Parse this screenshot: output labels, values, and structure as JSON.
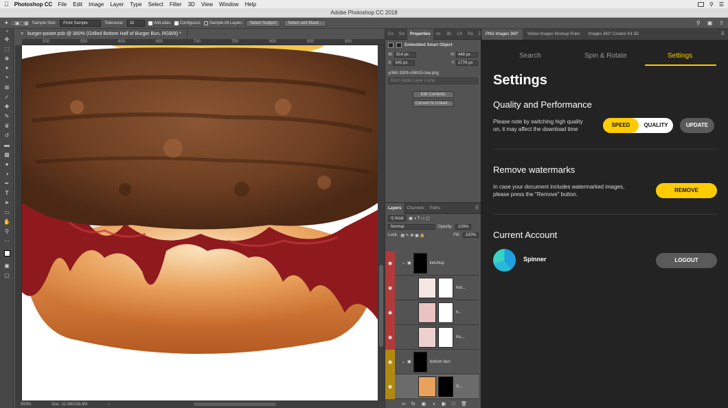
{
  "menubar": {
    "app_name": "Photoshop CC",
    "items": [
      "File",
      "Edit",
      "Image",
      "Layer",
      "Type",
      "Select",
      "Filter",
      "3D",
      "View",
      "Window",
      "Help"
    ]
  },
  "window": {
    "title": "Adobe Photoshop CC 2018"
  },
  "options_bar": {
    "sample_size_label": "Sample Size:",
    "sample_size_value": "Point Sample",
    "tolerance_label": "Tolerance:",
    "tolerance_value": "32",
    "anti_alias_label": "Anti-alias",
    "contiguous_label": "Contiguous",
    "sample_all_label": "Sample All Layers",
    "select_subject_label": "Select Subject",
    "select_mask_label": "Select and Mask..."
  },
  "document": {
    "tab_title": "burger-poster.psb @ 300% (Grilled Bottom Half of Burger Bun, RGB/8) *",
    "ruler_ticks": [
      "500",
      "550",
      "600",
      "650",
      "700",
      "750",
      "800",
      "850",
      "900",
      "950"
    ],
    "zoom": "300%",
    "doc_info": "Doc: 11.0M/158.6M"
  },
  "properties_panel": {
    "tabs": [
      "Co",
      "Sw",
      "Properties",
      "Ac",
      "3D",
      "Ch",
      "Pa"
    ],
    "object_type": "Embedded Smart Object",
    "w_label": "W:",
    "w_value": "914 px",
    "h_label": "H:",
    "h_value": "448 px",
    "x_label": "X:",
    "x_value": "345 px",
    "y_label": "Y:",
    "y_value": "1776 px",
    "filename": "yi360-3309-v06h15-low.png",
    "layer_comp": "Don't Apply Layer Comp",
    "edit_contents": "Edit Contents",
    "convert_linked": "Convert to Linked..."
  },
  "layers_panel": {
    "tabs": [
      "Layers",
      "Channels",
      "Paths"
    ],
    "filter_kind": "Kind",
    "blend_mode": "Normal",
    "opacity_label": "Opacity:",
    "opacity_value": "100%",
    "lock_label": "Lock:",
    "fill_label": "Fill:",
    "fill_value": "100%",
    "layers": [
      {
        "name": "ketchup",
        "type": "group",
        "color": "red"
      },
      {
        "name": "Ket...",
        "type": "smart",
        "color": "red"
      },
      {
        "name": "K...",
        "type": "smart",
        "color": "red"
      },
      {
        "name": "Ke...",
        "type": "smart",
        "color": "red"
      },
      {
        "name": "bottom bun",
        "type": "group",
        "color": "yellow"
      },
      {
        "name": "G...",
        "type": "smart",
        "color": "yellow"
      }
    ]
  },
  "plugin": {
    "tabs": [
      "PNG Images 360°",
      "Yellow Images Mockup Ruler",
      "Images 360° Creator Kit 3D"
    ],
    "nav": [
      "Search",
      "Spin & Rotate",
      "Settings"
    ],
    "title": "Settings",
    "quality": {
      "heading": "Quality and Performance",
      "description_1": "Please note by switching high quality",
      "description_2": "on, it may affect the download time",
      "speed_label": "SPEED",
      "quality_label": "QUALITY",
      "update_label": "UPDATE"
    },
    "watermarks": {
      "heading": "Remove watermarks",
      "description_1": "In case your document includes watermarked images,",
      "description_2": "please press the \"Remove\" button.",
      "remove_label": "REMOVE"
    },
    "account": {
      "heading": "Current Account",
      "username": "Spinner",
      "logout_label": "LOGOUT"
    },
    "accent_color": "#ffcc00"
  }
}
